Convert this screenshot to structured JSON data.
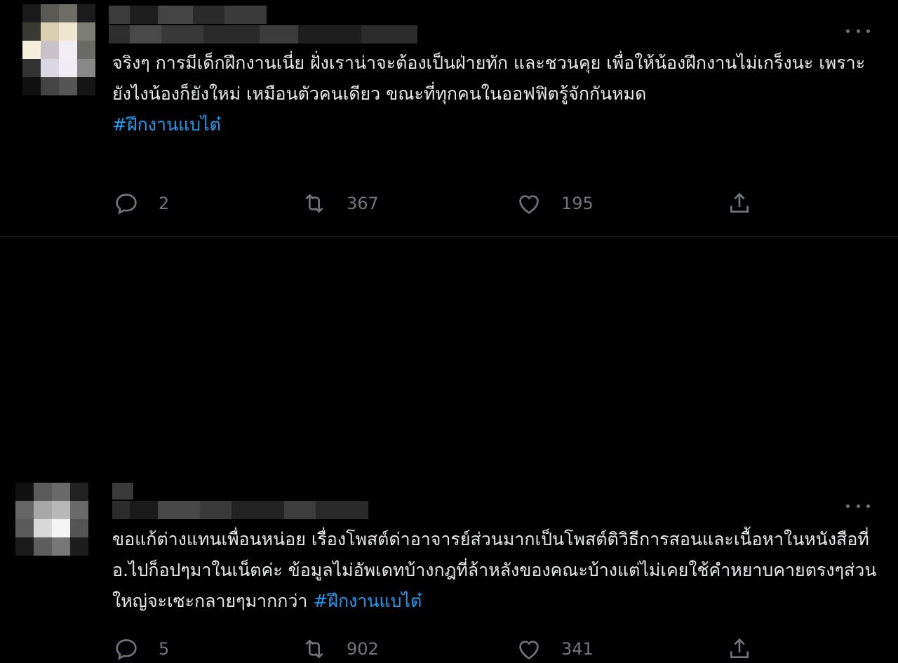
{
  "tweets": [
    {
      "text": "จริงๆ การมีเด็กฝึกงานเนี่ย ฝั่งเราน่าจะต้องเป็นฝ่ายทัก และชวนคุย เพื่อให้น้องฝึกงานไม่เกร็งนะ เพราะยังไงน้องก็ยังใหม่ เหมือนตัวคนเดียว ขณะที่ทุกคนในออฟฟิตรู้จักกันหมด",
      "hashtag": "#ฝึกงานแบไต๋",
      "replies": "2",
      "retweets": "367",
      "likes": "195"
    },
    {
      "text": "ขอแก้ต่างแทนเพื่อนหน่อย เรื่องโพสต์ด่าอาจารย์ส่วนมากเป็นโพสต์ติวิธีการสอนและเนื้อหาในหนังสือที่อ.ไปก็อปๆมาในเน็ตค่ะ ข้อมูลไม่อัพเดทบ้างกฎที่ล้าหลังของคณะบ้างแต่ไม่เคยใช้คำหยาบคายตรงๆส่วนใหญ่จะเซะกลายๆมากกว่า ",
      "hashtag": "#ฝึกงานแบไต๋",
      "replies": "5",
      "retweets": "902",
      "likes": "341"
    }
  ],
  "colors": {
    "background": "#000000",
    "text": "#e7e9ea",
    "muted": "#71767b",
    "link": "#1d9bf0",
    "divider": "#2f3336"
  },
  "icons": [
    "reply-icon",
    "retweet-icon",
    "like-icon",
    "share-icon",
    "more-icon"
  ]
}
